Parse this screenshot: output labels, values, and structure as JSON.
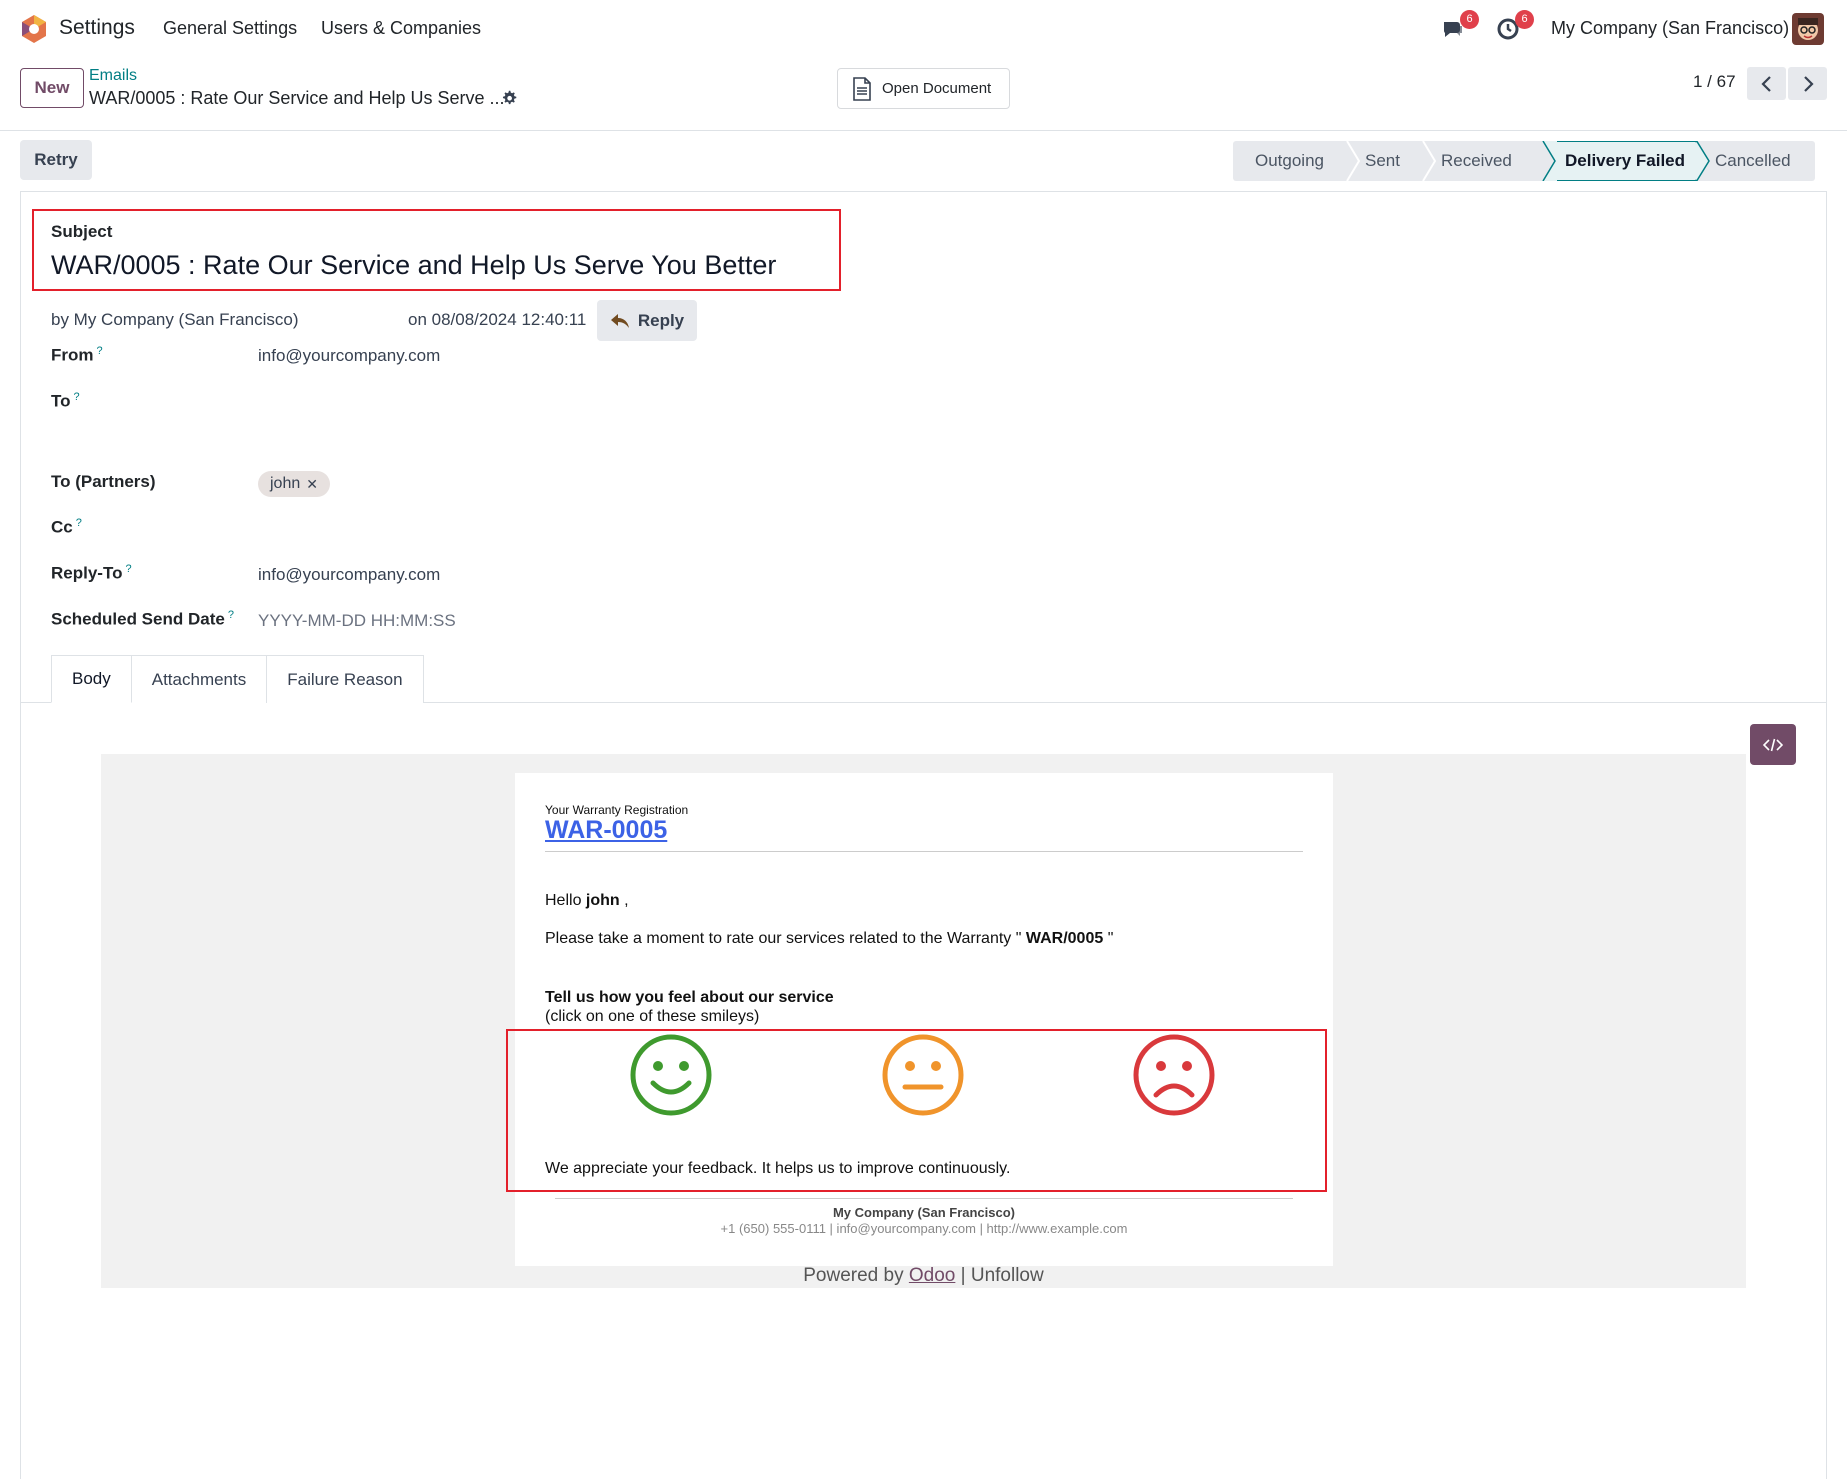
{
  "navbar": {
    "app_name": "Settings",
    "menu": [
      "General Settings",
      "Users & Companies"
    ],
    "messages_count": "6",
    "activities_count": "6",
    "company": "My Company (San Francisco)"
  },
  "control_panel": {
    "new_label": "New",
    "breadcrumb_parent": "Emails",
    "breadcrumb_current": "WAR/0005 : Rate Our Service and Help Us Serve ...",
    "open_document_label": "Open Document",
    "pager": "1 / 67"
  },
  "actions": {
    "retry_label": "Retry"
  },
  "statusbar": {
    "stages": [
      "Outgoing",
      "Sent",
      "Received",
      "Delivery Failed",
      "Cancelled"
    ],
    "active": "Delivery Failed"
  },
  "form": {
    "subject_label": "Subject",
    "subject_value": "WAR/0005 : Rate Our Service and Help Us Serve You Better",
    "by": "by My Company (San Francisco)",
    "on": "on 08/08/2024 12:40:11",
    "reply_label": "Reply",
    "fields": {
      "from_label": "From",
      "from_value": "info@yourcompany.com",
      "to_label": "To",
      "to_partners_label": "To (Partners)",
      "to_partners_tag": "john",
      "cc_label": "Cc",
      "reply_to_label": "Reply-To",
      "reply_to_value": "info@yourcompany.com",
      "scheduled_label": "Scheduled Send Date",
      "scheduled_placeholder": "YYYY-MM-DD HH:MM:SS"
    },
    "tooltip_mark": "?"
  },
  "tabs": [
    "Body",
    "Attachments",
    "Failure Reason"
  ],
  "email": {
    "header_small": "Your Warranty Registration",
    "reference": "WAR-0005",
    "hello": "Hello",
    "name": "john",
    "hello_suffix": ",",
    "rate_text_prefix": "Please take a moment to rate our services related to the Warranty \"",
    "rate_ref": "WAR/0005",
    "rate_text_suffix": "\"",
    "feel_title": "Tell us how you feel about our service",
    "feel_hint": "(click on one of these smileys)",
    "smileys": [
      "happy-smiley-icon",
      "neutral-smiley-icon",
      "sad-smiley-icon"
    ],
    "appreciate": "We appreciate your feedback. It helps us to improve continuously.",
    "footer_company": "My Company (San Francisco)",
    "footer_contact": "+1 (650) 555-0111 | info@yourcompany.com | http://www.example.com",
    "powered_by": "Powered by",
    "odoo": "Odoo",
    "separator": "|",
    "unfollow": "Unfollow"
  },
  "colors": {
    "brand": "#714b67",
    "teal": "#017e84",
    "highlight_red": "#e3202b",
    "happy": "#3f9a2e",
    "neutral": "#f0942b",
    "sad": "#d9393c"
  }
}
